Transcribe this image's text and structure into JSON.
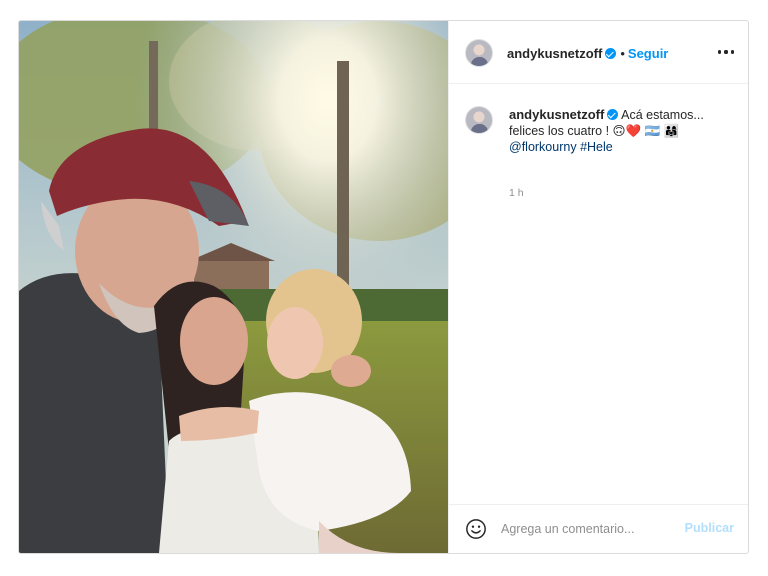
{
  "post": {
    "username": "andykusnetzoff",
    "verified": true,
    "separator": "•",
    "follow_label": "Seguir",
    "more_icon": "three-dots-icon",
    "photo_description_icon": "photo",
    "caption": {
      "username": "andykusnetzoff",
      "text_line1": "Acá estamos...",
      "text_line2": "felices los cuatro ! ",
      "emoji_glyphs": [
        "🙃",
        "❤️",
        "🇦🇷",
        "👨‍👩‍👧"
      ],
      "mention": "@florkourny",
      "hashtag": "#Hele"
    },
    "time": "1 h",
    "comment_placeholder": "Agrega un comentario...",
    "publish_label": "Publicar",
    "smiley_icon": "emoji-smiley-icon"
  },
  "colors": {
    "link_blue": "#0095f6",
    "mention_blue": "#00376b",
    "publish_disabled": "#b2dffc",
    "muted": "#8e8e8e"
  }
}
